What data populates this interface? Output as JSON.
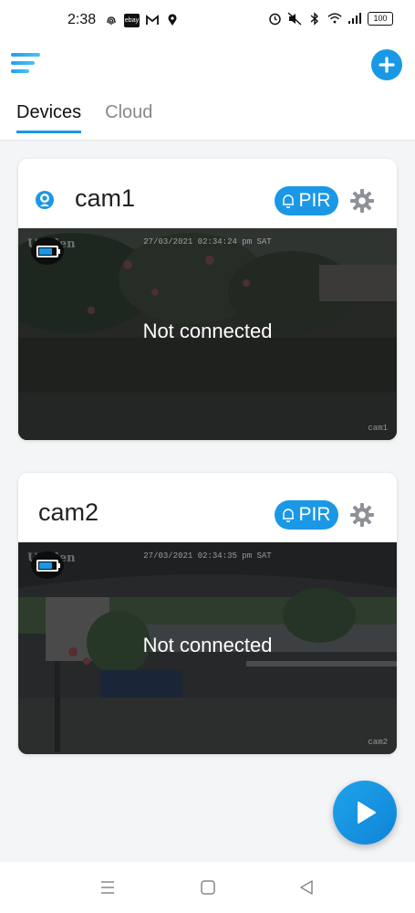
{
  "status_bar": {
    "time": "2:38",
    "left_icons": [
      "fingerprint-icon",
      "ebay-icon",
      "gmail-icon",
      "location-icon"
    ],
    "ebay_label": "ebay",
    "right_icons": [
      "alarm-icon",
      "mute-icon",
      "bluetooth-icon",
      "wifi-icon",
      "signal-icon",
      "battery-icon"
    ],
    "battery_level": "100"
  },
  "header": {
    "menu_icon": "menu-icon",
    "add_icon": "plus-icon",
    "tabs": [
      {
        "label": "Devices",
        "active": true
      },
      {
        "label": "Cloud",
        "active": false
      }
    ],
    "accent_color": "#1a98e6"
  },
  "cameras": [
    {
      "name": "cam1",
      "status_icon": "user-icon",
      "pir_label": "PIR",
      "feed_message": "Not connected",
      "feed_timestamp": "27/03/2021 02:34:24 pm SAT",
      "feed_watermark": "Uniden",
      "feed_label": "cam1",
      "battery_level": 0.75
    },
    {
      "name": "cam2",
      "pir_label": "PIR",
      "feed_message": "Not connected",
      "feed_timestamp": "27/03/2021 02:34:35 pm SAT",
      "feed_watermark": "Uniden",
      "feed_label": "cam2",
      "battery_level": 0.75
    }
  ],
  "play_icon": "play-icon",
  "nav": [
    "recents-icon",
    "home-icon",
    "back-icon"
  ]
}
